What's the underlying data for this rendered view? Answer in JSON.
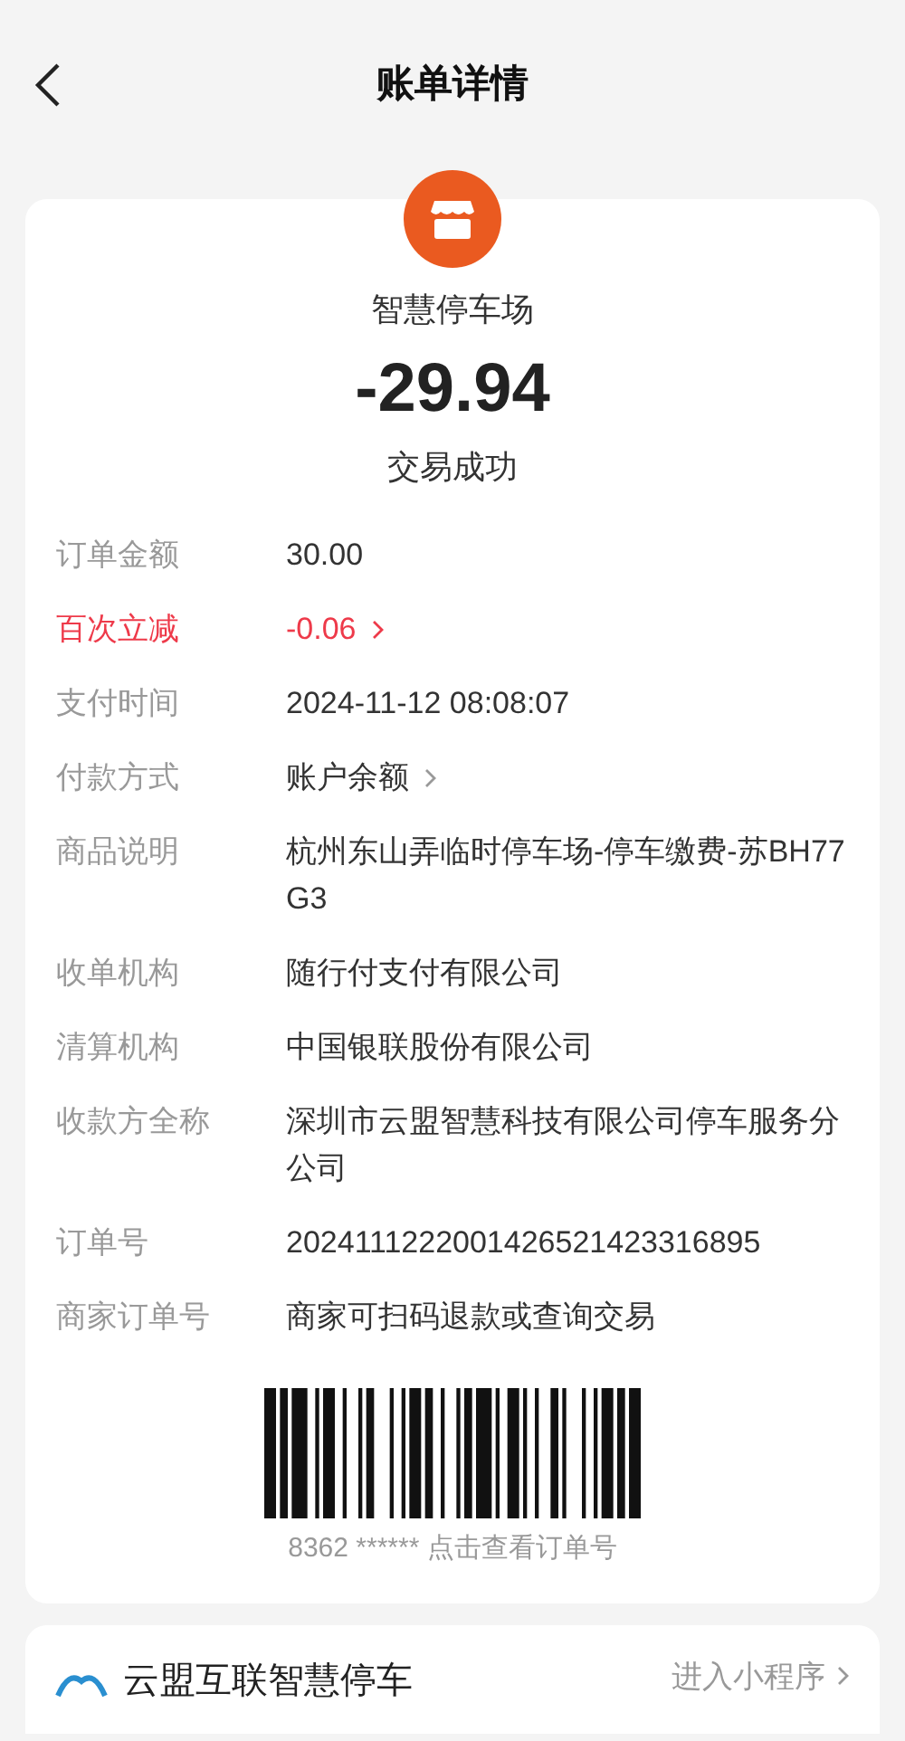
{
  "header": {
    "title": "账单详情"
  },
  "summary": {
    "merchant": "智慧停车场",
    "amount": "-29.94",
    "status": "交易成功"
  },
  "details": [
    {
      "label": "订单金额",
      "value": "30.00",
      "kind": "plain"
    },
    {
      "label": "百次立减",
      "value": "-0.06",
      "kind": "discount"
    },
    {
      "label": "支付时间",
      "value": "2024-11-12 08:08:07",
      "kind": "plain"
    },
    {
      "label": "付款方式",
      "value": "账户余额",
      "kind": "link"
    },
    {
      "label": "商品说明",
      "value": "杭州东山弄临时停车场-停车缴费-苏BH77G3",
      "kind": "plain"
    },
    {
      "label": "收单机构",
      "value": "随行付支付有限公司",
      "kind": "plain"
    },
    {
      "label": "清算机构",
      "value": "中国银联股份有限公司",
      "kind": "plain"
    },
    {
      "label": "收款方全称",
      "value": "深圳市云盟智慧科技有限公司停车服务分公司",
      "kind": "plain"
    },
    {
      "label": "订单号",
      "value": "2024111222001426521423316895",
      "kind": "plain"
    },
    {
      "label": "商家订单号",
      "value": "商家可扫码退款或查询交易",
      "kind": "plain"
    }
  ],
  "barcode": {
    "caption": "8362 ****** 点击查看订单号"
  },
  "mini_program": {
    "name": "云盟互联智慧停车",
    "action": "进入小程序"
  }
}
